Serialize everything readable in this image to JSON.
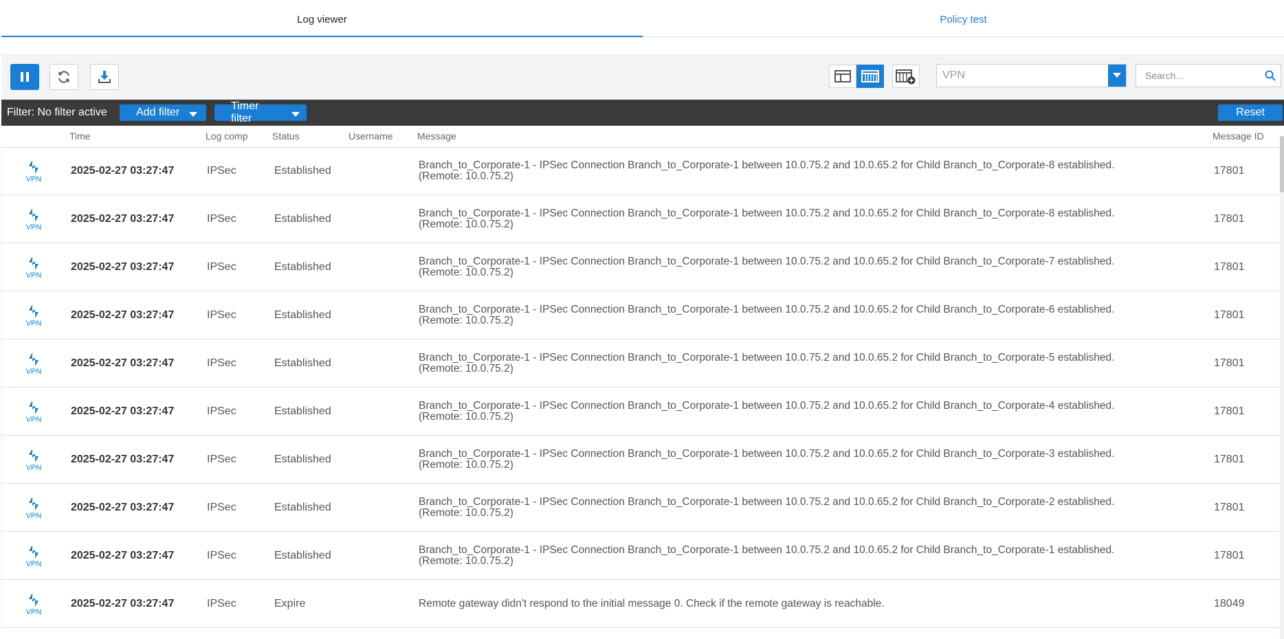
{
  "tabs": [
    {
      "label": "Log viewer",
      "active": true
    },
    {
      "label": "Policy test",
      "active": false
    }
  ],
  "toolbar": {
    "pause_icon": "pause-icon",
    "refresh_icon": "refresh-icon",
    "download_icon": "download-icon",
    "module_select": "VPN",
    "search_placeholder": "Search..."
  },
  "filterbar": {
    "label": "Filter: No filter active",
    "add_filter": "Add filter",
    "timer_filter": "Timer filter",
    "reset": "Reset"
  },
  "columns": {
    "time": "Time",
    "log_comp": "Log comp",
    "status": "Status",
    "username": "Username",
    "message": "Message",
    "message_id": "Message ID"
  },
  "rows": [
    {
      "type": "VPN",
      "time": "2025-02-27 03:27:47",
      "comp": "IPSec",
      "status": "Established",
      "username": "",
      "msg1": "Branch_to_Corporate-1 - IPSec Connection Branch_to_Corporate-1 between 10.0.75.2 and 10.0.65.2 for Child Branch_to_Corporate-8 established.",
      "msg2": "(Remote: 10.0.75.2)",
      "id": "17801"
    },
    {
      "type": "VPN",
      "time": "2025-02-27 03:27:47",
      "comp": "IPSec",
      "status": "Established",
      "username": "",
      "msg1": "Branch_to_Corporate-1 - IPSec Connection Branch_to_Corporate-1 between 10.0.75.2 and 10.0.65.2 for Child Branch_to_Corporate-8 established.",
      "msg2": "(Remote: 10.0.75.2)",
      "id": "17801"
    },
    {
      "type": "VPN",
      "time": "2025-02-27 03:27:47",
      "comp": "IPSec",
      "status": "Established",
      "username": "",
      "msg1": "Branch_to_Corporate-1 - IPSec Connection Branch_to_Corporate-1 between 10.0.75.2 and 10.0.65.2 for Child Branch_to_Corporate-7 established.",
      "msg2": "(Remote: 10.0.75.2)",
      "id": "17801"
    },
    {
      "type": "VPN",
      "time": "2025-02-27 03:27:47",
      "comp": "IPSec",
      "status": "Established",
      "username": "",
      "msg1": "Branch_to_Corporate-1 - IPSec Connection Branch_to_Corporate-1 between 10.0.75.2 and 10.0.65.2 for Child Branch_to_Corporate-6 established.",
      "msg2": "(Remote: 10.0.75.2)",
      "id": "17801"
    },
    {
      "type": "VPN",
      "time": "2025-02-27 03:27:47",
      "comp": "IPSec",
      "status": "Established",
      "username": "",
      "msg1": "Branch_to_Corporate-1 - IPSec Connection Branch_to_Corporate-1 between 10.0.75.2 and 10.0.65.2 for Child Branch_to_Corporate-5 established.",
      "msg2": "(Remote: 10.0.75.2)",
      "id": "17801"
    },
    {
      "type": "VPN",
      "time": "2025-02-27 03:27:47",
      "comp": "IPSec",
      "status": "Established",
      "username": "",
      "msg1": "Branch_to_Corporate-1 - IPSec Connection Branch_to_Corporate-1 between 10.0.75.2 and 10.0.65.2 for Child Branch_to_Corporate-4 established.",
      "msg2": "(Remote: 10.0.75.2)",
      "id": "17801"
    },
    {
      "type": "VPN",
      "time": "2025-02-27 03:27:47",
      "comp": "IPSec",
      "status": "Established",
      "username": "",
      "msg1": "Branch_to_Corporate-1 - IPSec Connection Branch_to_Corporate-1 between 10.0.75.2 and 10.0.65.2 for Child Branch_to_Corporate-3 established.",
      "msg2": "(Remote: 10.0.75.2)",
      "id": "17801"
    },
    {
      "type": "VPN",
      "time": "2025-02-27 03:27:47",
      "comp": "IPSec",
      "status": "Established",
      "username": "",
      "msg1": "Branch_to_Corporate-1 - IPSec Connection Branch_to_Corporate-1 between 10.0.75.2 and 10.0.65.2 for Child Branch_to_Corporate-2 established.",
      "msg2": "(Remote: 10.0.75.2)",
      "id": "17801"
    },
    {
      "type": "VPN",
      "time": "2025-02-27 03:27:47",
      "comp": "IPSec",
      "status": "Established",
      "username": "",
      "msg1": "Branch_to_Corporate-1 - IPSec Connection Branch_to_Corporate-1 between 10.0.75.2 and 10.0.65.2 for Child Branch_to_Corporate-1 established.",
      "msg2": "(Remote: 10.0.75.2)",
      "id": "17801"
    },
    {
      "type": "VPN",
      "time": "2025-02-27 03:27:47",
      "comp": "IPSec",
      "status": "Expire",
      "username": "",
      "msg1": "Remote gateway didn't respond to the initial message 0. Check if the remote gateway is reachable.",
      "msg2": "",
      "id": "18049"
    }
  ],
  "colors": {
    "accent": "#1a7fd4",
    "filterbar_bg": "#3b3b3b",
    "toolbar_bg": "#f3f4f5"
  }
}
